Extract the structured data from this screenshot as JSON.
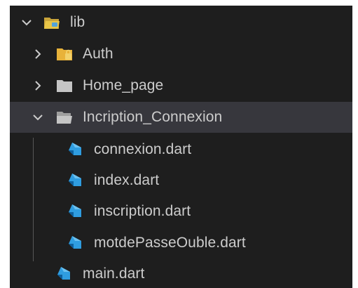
{
  "explorer": {
    "items": [
      {
        "label": "lib",
        "kind": "folder-open",
        "expanded": true,
        "icon": "folder-lib-icon"
      },
      {
        "label": "Auth",
        "kind": "folder",
        "expanded": false,
        "icon": "folder-lock-icon"
      },
      {
        "label": "Home_page",
        "kind": "folder",
        "expanded": false,
        "icon": "folder-icon"
      },
      {
        "label": "Incription_Connexion",
        "kind": "folder-open",
        "expanded": true,
        "selected": true,
        "icon": "folder-open-icon"
      },
      {
        "label": "connexion.dart",
        "kind": "file",
        "icon": "dart-file-icon"
      },
      {
        "label": "index.dart",
        "kind": "file",
        "icon": "dart-file-icon"
      },
      {
        "label": "inscription.dart",
        "kind": "file",
        "icon": "dart-file-icon"
      },
      {
        "label": "motdePasseOuble.dart",
        "kind": "file",
        "icon": "dart-file-icon"
      },
      {
        "label": "main.dart",
        "kind": "file",
        "icon": "dart-file-icon"
      }
    ]
  },
  "colors": {
    "background": "#1e1e1e",
    "selected_row": "#37373d",
    "text": "#cccccc",
    "folder_yellow": "#e8c547",
    "folder_gray": "#c5c5c5",
    "dart_blue": "#2f9de0",
    "dart_dark": "#0d5f9c"
  }
}
